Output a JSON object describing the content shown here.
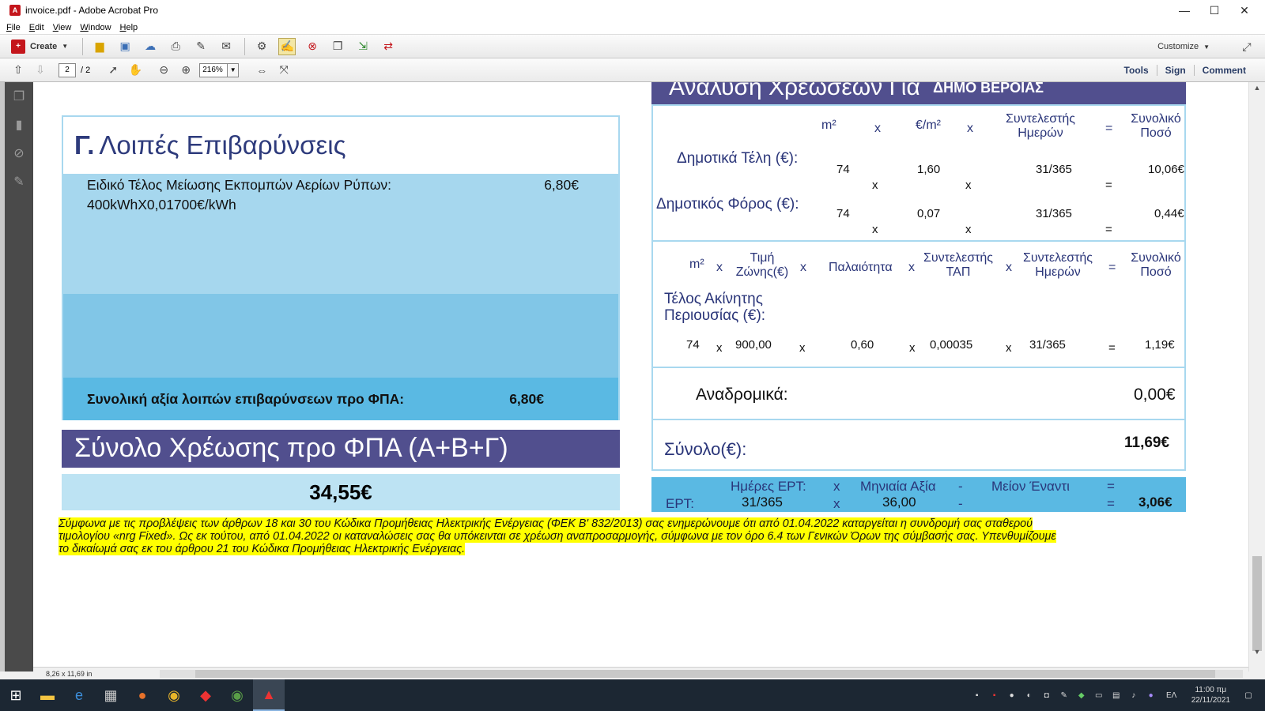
{
  "window": {
    "title": "invoice.pdf - Adobe Acrobat Pro",
    "minimize": "—",
    "maximize": "☐",
    "close": "✕"
  },
  "menu": [
    "File",
    "Edit",
    "View",
    "Window",
    "Help"
  ],
  "toolbar": {
    "create_label": "Create",
    "customize_label": "Customize"
  },
  "nav": {
    "page_value": "2",
    "page_total": "/ 2",
    "zoom_value": "216%",
    "tools": "Tools",
    "sign": "Sign",
    "comment": "Comment"
  },
  "status": {
    "page_size": "8,26 x 11,69 in"
  },
  "left_section": {
    "heading_letter": "Γ.",
    "heading_text": "Λοιπές Επιβαρύνσεις",
    "item_line1": "Ειδικό Τέλος Μείωσης Εκπομπών Αερίων Ρύπων:",
    "item_line2": "400kWhX0,01700€/kWh",
    "item_value": "6,80€",
    "subtotal_label": "Συνολική αξία λοιπών επιβαρύνσεων προ ΦΠΑ:",
    "subtotal_value": "6,80€",
    "total_label": "Σύνολο Χρέωσης προ ΦΠΑ (Α+Β+Γ)",
    "total_value": "34,55€"
  },
  "right_section": {
    "title": "Ανάλυση Χρεώσεων Για",
    "title_sub": "ΔΗΜΟ ΒΕΡΟΙΑΣ",
    "box1": {
      "h_m2": "m²",
      "h_x": "x",
      "h_eur_m2": "€/m²",
      "h_coef_1": "Συντελεστής",
      "h_coef_2": "Ημερών",
      "h_eq": "=",
      "h_total_1": "Συνολικό",
      "h_total_2": "Ποσό",
      "row1_label": "Δημοτικά Τέλη (€):",
      "row1_m2": "74",
      "row1_rate": "1,60",
      "row1_days": "31/365",
      "row1_total": "10,06€",
      "row2_label": "Δημοτικός Φόρος (€):",
      "row2_m2": "74",
      "row2_rate": "0,07",
      "row2_days": "31/365",
      "row2_total": "0,44€"
    },
    "box2": {
      "h_m2": "m²",
      "h_x": "x",
      "h_zone_1": "Τιμή",
      "h_zone_2": "Ζώνης(€)",
      "h_age": "Παλαιότητα",
      "h_tap_1": "Συντελεστής",
      "h_tap_2": "ΤΑΠ",
      "h_coef_1": "Συντελεστής",
      "h_coef_2": "Ημερών",
      "h_eq": "=",
      "h_total_1": "Συνολικό",
      "h_total_2": "Ποσό",
      "label_1": "Τέλος Ακίνητης",
      "label_2": "Περιουσίας (€):",
      "m2": "74",
      "zone": "900,00",
      "age": "0,60",
      "tap": "0,00035",
      "days": "31/365",
      "total": "1,19€"
    },
    "retro_label": "Αναδρομικά:",
    "retro_value": "0,00€",
    "sum_label": "Σύνολο(€):",
    "sum_value": "11,69€",
    "ert": {
      "label": "ΕΡΤ:",
      "h_days": "Ημέρες ΕΡΤ:",
      "h_monthly": "Μηνιαία Αξία",
      "h_minus_label": "Μείον Έναντι",
      "x": "x",
      "dash": "-",
      "eq": "=",
      "days": "31/365",
      "monthly": "36,00",
      "total": "3,06€"
    }
  },
  "notice": {
    "line1": "Σύμφωνα με τις προβλέψεις των άρθρων 18 και 30 του Κώδικα Προμήθειας Ηλεκτρικής Ενέργειας (ΦΕΚ Β' 832/2013) σας ενημερώνουμε ότι από 01.04.2022 καταργείται η συνδρομή σας σταθερού",
    "line2": "τιμολογίου «nrg Fixed». Ως εκ τούτου, από 01.04.2022 οι καταναλώσεις σας θα υπόκεινται σε χρέωση αναπροσαρμογής, σύμφωνα με τον όρο 6.4 των Γενικών Όρων της σύμβασής σας. Υπενθυμίζουμε",
    "line3": "το δικαίωμά σας εκ του άρθρου 21 του Κώδικα Προμήθειας Ηλεκτρικής Ενέργειας."
  },
  "taskbar": {
    "time": "11:00 πμ",
    "date": "22/11/2021",
    "lang": "ΕΛ"
  },
  "colors": {
    "purple": "#514f8e",
    "light_blue": "#a6d7ee",
    "mid_blue": "#5ab9e3",
    "highlight": "#ffff00"
  }
}
